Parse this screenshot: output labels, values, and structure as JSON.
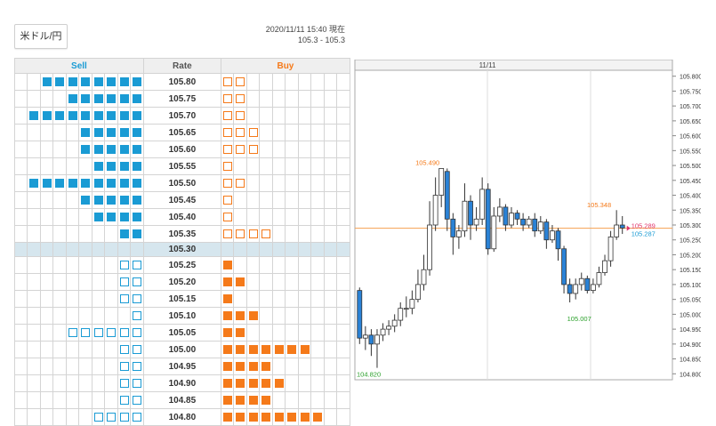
{
  "pair_button": "米ドル/円",
  "timestamp": {
    "line1": "2020/11/11 15:40 現在",
    "line2": "105.3 - 105.3"
  },
  "board": {
    "headers": {
      "sell": "Sell",
      "rate": "Rate",
      "buy": "Buy"
    },
    "rows": [
      {
        "rate": "105.80",
        "sell": 8,
        "sell_outline": false,
        "buy": 2,
        "buy_outline": true
      },
      {
        "rate": "105.75",
        "sell": 6,
        "sell_outline": false,
        "buy": 2,
        "buy_outline": true
      },
      {
        "rate": "105.70",
        "sell": 9,
        "sell_outline": false,
        "buy": 2,
        "buy_outline": true
      },
      {
        "rate": "105.65",
        "sell": 5,
        "sell_outline": false,
        "buy": 3,
        "buy_outline": true
      },
      {
        "rate": "105.60",
        "sell": 5,
        "sell_outline": false,
        "buy": 3,
        "buy_outline": true
      },
      {
        "rate": "105.55",
        "sell": 4,
        "sell_outline": false,
        "buy": 1,
        "buy_outline": true
      },
      {
        "rate": "105.50",
        "sell": 9,
        "sell_outline": false,
        "buy": 2,
        "buy_outline": true
      },
      {
        "rate": "105.45",
        "sell": 5,
        "sell_outline": false,
        "buy": 1,
        "buy_outline": true
      },
      {
        "rate": "105.40",
        "sell": 4,
        "sell_outline": false,
        "buy": 1,
        "buy_outline": true
      },
      {
        "rate": "105.35",
        "sell": 2,
        "sell_outline": false,
        "buy": 4,
        "buy_outline": true
      },
      {
        "rate": "105.30",
        "sell": 0,
        "sell_outline": true,
        "buy": 0,
        "buy_outline": false,
        "current": true
      },
      {
        "rate": "105.25",
        "sell": 2,
        "sell_outline": true,
        "buy": 1,
        "buy_outline": false
      },
      {
        "rate": "105.20",
        "sell": 2,
        "sell_outline": true,
        "buy": 2,
        "buy_outline": false
      },
      {
        "rate": "105.15",
        "sell": 2,
        "sell_outline": true,
        "buy": 1,
        "buy_outline": false
      },
      {
        "rate": "105.10",
        "sell": 1,
        "sell_outline": true,
        "buy": 3,
        "buy_outline": false
      },
      {
        "rate": "105.05",
        "sell": 6,
        "sell_outline": true,
        "buy": 2,
        "buy_outline": false
      },
      {
        "rate": "105.00",
        "sell": 2,
        "sell_outline": true,
        "buy": 7,
        "buy_outline": false
      },
      {
        "rate": "104.95",
        "sell": 2,
        "sell_outline": true,
        "buy": 4,
        "buy_outline": false
      },
      {
        "rate": "104.90",
        "sell": 2,
        "sell_outline": true,
        "buy": 5,
        "buy_outline": false
      },
      {
        "rate": "104.85",
        "sell": 2,
        "sell_outline": true,
        "buy": 4,
        "buy_outline": false
      },
      {
        "rate": "104.80",
        "sell": 4,
        "sell_outline": true,
        "buy": 8,
        "buy_outline": false
      }
    ]
  },
  "chart_data": {
    "type": "candlestick",
    "date_label": "11/11",
    "y_ticks": [
      "105.800",
      "105.750",
      "105.700",
      "105.650",
      "105.600",
      "105.550",
      "105.500",
      "105.450",
      "105.400",
      "105.350",
      "105.300",
      "105.250",
      "105.200",
      "105.150",
      "105.100",
      "105.050",
      "105.000",
      "104.950",
      "104.900",
      "104.850",
      "104.800"
    ],
    "ylim": [
      104.78,
      105.82
    ],
    "annotations": [
      {
        "text": "105.490",
        "value": 105.49,
        "color": "#f57a1a"
      },
      {
        "text": "105.348",
        "value": 105.348,
        "color": "#f57a1a"
      },
      {
        "text": "105.007",
        "value": 105.007,
        "color": "#2aa02a"
      },
      {
        "text": "104.820",
        "value": 104.82,
        "color": "#2aa02a"
      },
      {
        "text": "105.289",
        "value": 105.289,
        "color": "#e0336b"
      },
      {
        "text": "105.287",
        "value": 105.287,
        "color": "#1a9bd4"
      }
    ],
    "current_line": 105.289,
    "candles": [
      [
        105.08,
        104.92,
        105.09,
        104.9
      ],
      [
        104.92,
        104.93,
        104.96,
        104.88
      ],
      [
        104.93,
        104.9,
        104.95,
        104.86
      ],
      [
        104.9,
        104.93,
        104.95,
        104.82
      ],
      [
        104.93,
        104.95,
        104.97,
        104.91
      ],
      [
        104.95,
        104.96,
        104.98,
        104.93
      ],
      [
        104.96,
        104.98,
        105.0,
        104.94
      ],
      [
        104.98,
        105.02,
        105.04,
        104.96
      ],
      [
        105.02,
        105.02,
        105.06,
        104.99
      ],
      [
        105.02,
        105.05,
        105.08,
        105.0
      ],
      [
        105.05,
        105.1,
        105.15,
        105.04
      ],
      [
        105.1,
        105.15,
        105.2,
        105.08
      ],
      [
        105.15,
        105.3,
        105.38,
        105.13
      ],
      [
        105.3,
        105.4,
        105.46,
        105.28
      ],
      [
        105.4,
        105.49,
        105.49,
        105.36
      ],
      [
        105.48,
        105.32,
        105.49,
        105.28
      ],
      [
        105.32,
        105.26,
        105.34,
        105.2
      ],
      [
        105.26,
        105.28,
        105.3,
        105.22
      ],
      [
        105.28,
        105.38,
        105.44,
        105.26
      ],
      [
        105.38,
        105.3,
        105.4,
        105.25
      ],
      [
        105.3,
        105.32,
        105.36,
        105.28
      ],
      [
        105.32,
        105.42,
        105.46,
        105.3
      ],
      [
        105.42,
        105.22,
        105.44,
        105.2
      ],
      [
        105.22,
        105.33,
        105.36,
        105.21
      ],
      [
        105.33,
        105.36,
        105.39,
        105.31
      ],
      [
        105.36,
        105.3,
        105.37,
        105.28
      ],
      [
        105.3,
        105.34,
        105.36,
        105.29
      ],
      [
        105.34,
        105.32,
        105.35,
        105.3
      ],
      [
        105.32,
        105.3,
        105.34,
        105.28
      ],
      [
        105.3,
        105.32,
        105.33,
        105.29
      ],
      [
        105.32,
        105.28,
        105.34,
        105.26
      ],
      [
        105.28,
        105.31,
        105.33,
        105.27
      ],
      [
        105.31,
        105.25,
        105.32,
        105.22
      ],
      [
        105.25,
        105.28,
        105.3,
        105.24
      ],
      [
        105.28,
        105.22,
        105.29,
        105.18
      ],
      [
        105.22,
        105.1,
        105.23,
        105.07
      ],
      [
        105.1,
        105.07,
        105.12,
        105.04
      ],
      [
        105.07,
        105.1,
        105.12,
        105.05
      ],
      [
        105.1,
        105.12,
        105.14,
        105.08
      ],
      [
        105.12,
        105.08,
        105.13,
        105.07
      ],
      [
        105.08,
        105.1,
        105.12,
        105.07
      ],
      [
        105.1,
        105.14,
        105.16,
        105.09
      ],
      [
        105.14,
        105.18,
        105.2,
        105.13
      ],
      [
        105.18,
        105.26,
        105.28,
        105.16
      ],
      [
        105.26,
        105.3,
        105.35,
        105.25
      ],
      [
        105.3,
        105.29,
        105.33,
        105.27
      ]
    ]
  }
}
